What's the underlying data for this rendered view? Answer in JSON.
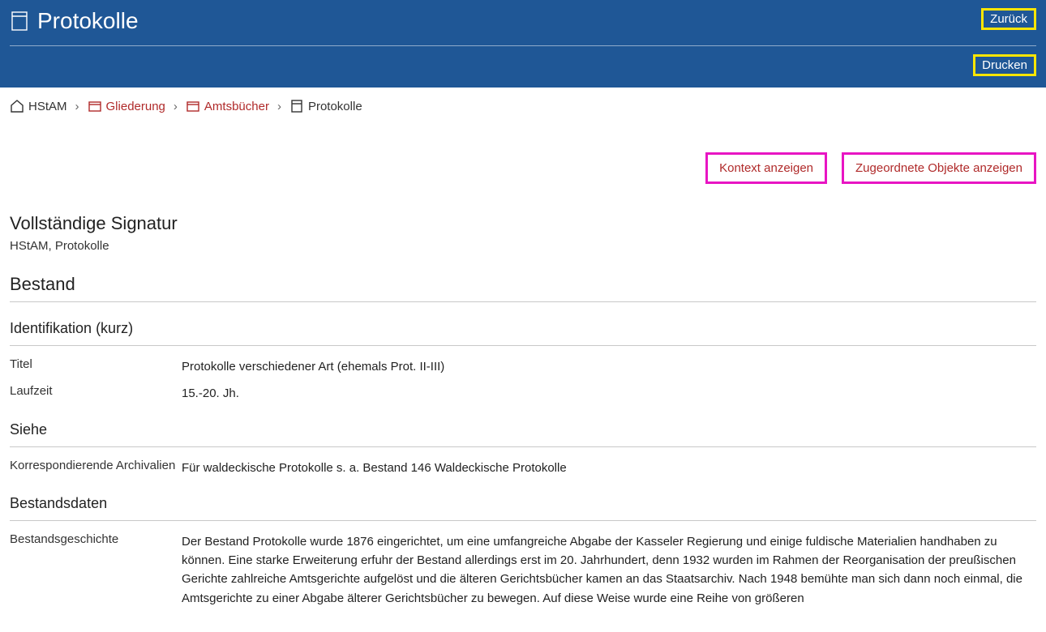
{
  "header": {
    "title": "Protokolle",
    "back_label": "Zurück",
    "print_label": "Drucken"
  },
  "breadcrumb": {
    "items": [
      {
        "label": "HStAM",
        "icon": "home",
        "link": false
      },
      {
        "label": "Gliederung",
        "icon": "folder",
        "link": true
      },
      {
        "label": "Amtsbücher",
        "icon": "folder",
        "link": true
      },
      {
        "label": "Protokolle",
        "icon": "doc",
        "link": false
      }
    ]
  },
  "actions": {
    "context_label": "Kontext anzeigen",
    "assigned_label": "Zugeordnete Objekte anzeigen"
  },
  "signature": {
    "heading": "Vollständige Signatur",
    "value": "HStAM, Protokolle"
  },
  "bestand": {
    "heading": "Bestand",
    "ident_heading": "Identifikation (kurz)",
    "fields": {
      "titel_label": "Titel",
      "titel_value": "Protokolle verschiedener Art (ehemals Prot. II-III)",
      "laufzeit_label": "Laufzeit",
      "laufzeit_value": "15.-20. Jh."
    },
    "siehe_heading": "Siehe",
    "siehe_fields": {
      "korr_label": "Korrespondierende Archivalien",
      "korr_value": "Für waldeckische Protokolle s. a. Bestand 146 Waldeckische Protokolle"
    },
    "daten_heading": "Bestandsdaten",
    "daten_fields": {
      "geschichte_label": "Bestandsgeschichte",
      "geschichte_value": "Der Bestand Protokolle wurde 1876 eingerichtet, um eine umfangreiche Abgabe der Kasseler Regierung und einige fuldische Materialien handhaben zu können. Eine starke Erweiterung erfuhr der Bestand allerdings erst im 20. Jahrhundert, denn 1932 wurden im Rahmen der Reorganisation der preußischen Gerichte zahlreiche Amtsgerichte aufgelöst und die älteren Gerichtsbücher kamen an das Staatsarchiv. Nach 1948 bemühte man sich dann noch einmal, die Amtsgerichte zu einer Abgabe älterer Gerichtsbücher zu bewegen. Auf diese Weise wurde eine Reihe von größeren"
    }
  }
}
